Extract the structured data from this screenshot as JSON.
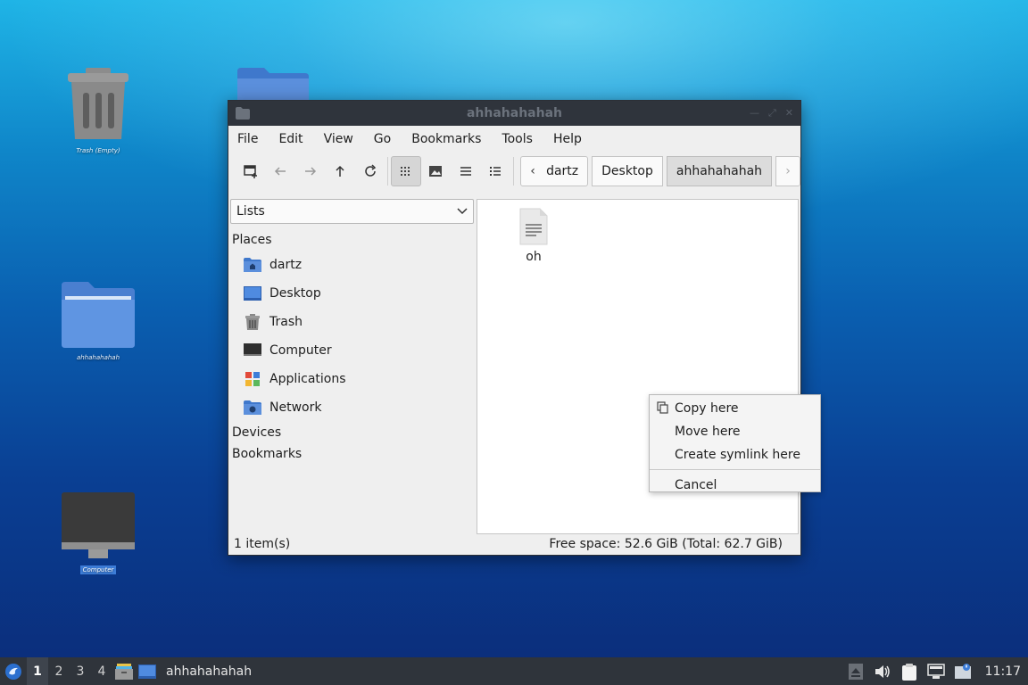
{
  "desktop": {
    "icons": [
      {
        "label": "Trash (Empty)"
      },
      {
        "label": "ahhahahahah"
      },
      {
        "label": "Computer"
      }
    ]
  },
  "window": {
    "title": "ahhahahahah",
    "menu": [
      "File",
      "Edit",
      "View",
      "Go",
      "Bookmarks",
      "Tools",
      "Help"
    ],
    "path": [
      "dartz",
      "Desktop",
      "ahhahahahah"
    ],
    "sidebar": {
      "select_value": "Lists",
      "places_header": "Places",
      "places": [
        "dartz",
        "Desktop",
        "Trash",
        "Computer",
        "Applications",
        "Network"
      ],
      "devices_header": "Devices",
      "bookmarks_header": "Bookmarks"
    },
    "files": [
      {
        "name": "oh"
      }
    ],
    "status": {
      "count": "1 item(s)",
      "free_space": "Free space: 52.6 GiB (Total: 62.7 GiB)"
    }
  },
  "context_menu": {
    "items": [
      "Copy here",
      "Move here",
      "Create symlink here"
    ],
    "cancel": "Cancel"
  },
  "taskbar": {
    "workspaces": [
      "1",
      "2",
      "3",
      "4"
    ],
    "active_workspace": "1",
    "task_title": "ahhahahahah",
    "clock": "11:17"
  },
  "colors": {
    "accent": "#3d7dd8",
    "titlebar": "#2f343c",
    "taskbar": "#2f343b"
  }
}
